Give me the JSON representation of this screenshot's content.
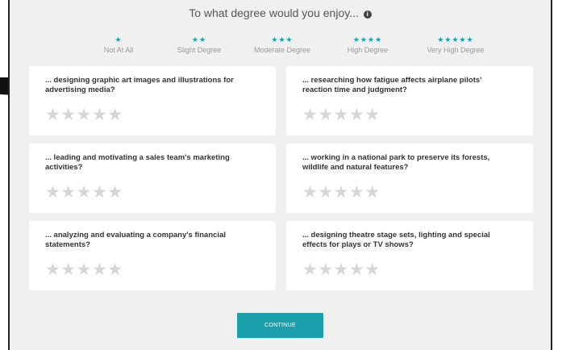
{
  "header": {
    "title": "To what degree would you enjoy...",
    "info_icon": "info-icon"
  },
  "scale": [
    {
      "stars": "★",
      "label": "Not At All"
    },
    {
      "stars": "★★",
      "label": "Slight Degree"
    },
    {
      "stars": "★★★",
      "label": "Moderate Degree"
    },
    {
      "stars": "★★★★",
      "label": "High Degree"
    },
    {
      "stars": "★★★★★",
      "label": "Very High Degree"
    }
  ],
  "questions": [
    {
      "text": "... designing graphic art images and illustrations for advertising media?",
      "rating": 0
    },
    {
      "text": "... researching how fatigue affects airplane pilots' reaction time and judgment?",
      "rating": 0
    },
    {
      "text": "... leading and motivating a sales team's marketing activities?",
      "rating": 0
    },
    {
      "text": "... working in a national park to preserve its forests, wildlife and natural features?",
      "rating": 0
    },
    {
      "text": "... analyzing and evaluating a company's financial statements?",
      "rating": 0
    },
    {
      "text": "... designing theatre stage sets, lighting and special effects for plays or TV shows?",
      "rating": 0
    }
  ],
  "star_glyphs": "★★★★★",
  "colors": {
    "accent": "#1aa0ad",
    "empty_star": "#d6d6d6",
    "background": "#f0f0f0"
  },
  "continue_label": "CONTINUE"
}
